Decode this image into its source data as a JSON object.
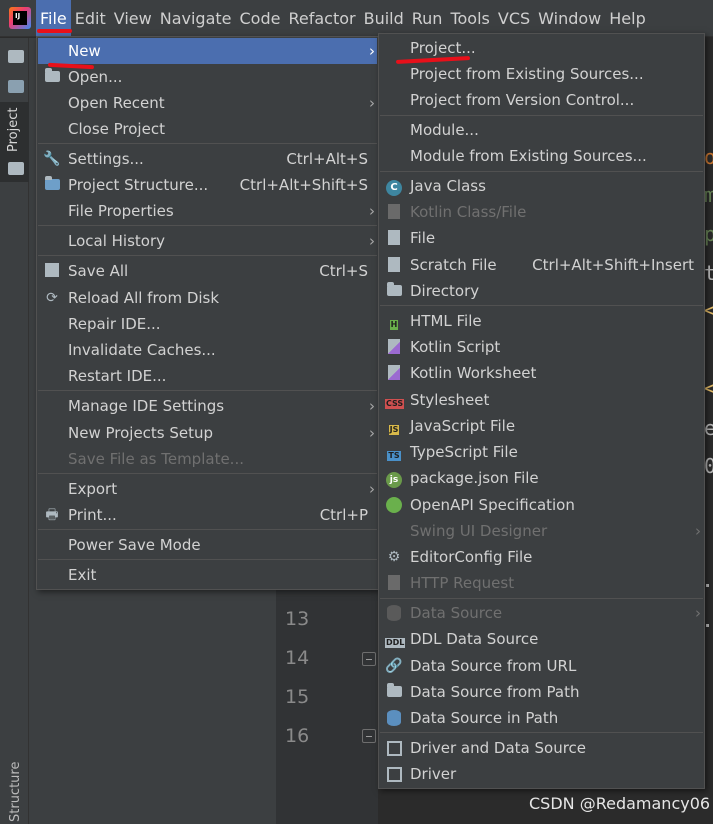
{
  "menubar": {
    "logo_text": "IJ",
    "items": [
      "File",
      "Edit",
      "View",
      "Navigate",
      "Code",
      "Refactor",
      "Build",
      "Run",
      "Tools",
      "VCS",
      "Window",
      "Help"
    ]
  },
  "sidebar": {
    "project_label": "Project",
    "structure_label": "Structure"
  },
  "gutter": {
    "line_numbers": [
      "13",
      "14",
      "15",
      "16"
    ]
  },
  "editor": {
    "code_chars": [
      "o",
      "m",
      "p",
      "t",
      "<",
      "<",
      "e",
      "0"
    ]
  },
  "watermark": "CSDN @Redamancy06",
  "file_menu": {
    "items": [
      {
        "label": "New",
        "shortcut": "",
        "arrow": "›"
      },
      {
        "label": "Open...",
        "shortcut": "",
        "arrow": ""
      },
      {
        "label": "Open Recent",
        "shortcut": "",
        "arrow": "›"
      },
      {
        "label": "Close Project",
        "shortcut": "",
        "arrow": ""
      },
      {
        "label": "Settings...",
        "shortcut": "Ctrl+Alt+S",
        "arrow": ""
      },
      {
        "label": "Project Structure...",
        "shortcut": "Ctrl+Alt+Shift+S",
        "arrow": ""
      },
      {
        "label": "File Properties",
        "shortcut": "",
        "arrow": "›"
      },
      {
        "label": "Local History",
        "shortcut": "",
        "arrow": "›"
      },
      {
        "label": "Save All",
        "shortcut": "Ctrl+S",
        "arrow": ""
      },
      {
        "label": "Reload All from Disk",
        "shortcut": "",
        "arrow": ""
      },
      {
        "label": "Repair IDE...",
        "shortcut": "",
        "arrow": ""
      },
      {
        "label": "Invalidate Caches...",
        "shortcut": "",
        "arrow": ""
      },
      {
        "label": "Restart IDE...",
        "shortcut": "",
        "arrow": ""
      },
      {
        "label": "Manage IDE Settings",
        "shortcut": "",
        "arrow": "›"
      },
      {
        "label": "New Projects Setup",
        "shortcut": "",
        "arrow": "›"
      },
      {
        "label": "Save File as Template...",
        "shortcut": "",
        "arrow": ""
      },
      {
        "label": "Export",
        "shortcut": "",
        "arrow": "›"
      },
      {
        "label": "Print...",
        "shortcut": "Ctrl+P",
        "arrow": ""
      },
      {
        "label": "Power Save Mode",
        "shortcut": "",
        "arrow": ""
      },
      {
        "label": "Exit",
        "shortcut": "",
        "arrow": ""
      }
    ]
  },
  "new_menu": {
    "items": [
      {
        "label": "Project...",
        "shortcut": "",
        "arrow": ""
      },
      {
        "label": "Project from Existing Sources...",
        "shortcut": "",
        "arrow": ""
      },
      {
        "label": "Project from Version Control...",
        "shortcut": "",
        "arrow": ""
      },
      {
        "label": "Module...",
        "shortcut": "",
        "arrow": ""
      },
      {
        "label": "Module from Existing Sources...",
        "shortcut": "",
        "arrow": ""
      },
      {
        "label": "Java Class",
        "shortcut": "",
        "arrow": ""
      },
      {
        "label": "Kotlin Class/File",
        "shortcut": "",
        "arrow": ""
      },
      {
        "label": "File",
        "shortcut": "",
        "arrow": ""
      },
      {
        "label": "Scratch File",
        "shortcut": "Ctrl+Alt+Shift+Insert",
        "arrow": ""
      },
      {
        "label": "Directory",
        "shortcut": "",
        "arrow": ""
      },
      {
        "label": "HTML File",
        "shortcut": "",
        "arrow": ""
      },
      {
        "label": "Kotlin Script",
        "shortcut": "",
        "arrow": ""
      },
      {
        "label": "Kotlin Worksheet",
        "shortcut": "",
        "arrow": ""
      },
      {
        "label": "Stylesheet",
        "shortcut": "",
        "arrow": ""
      },
      {
        "label": "JavaScript File",
        "shortcut": "",
        "arrow": ""
      },
      {
        "label": "TypeScript File",
        "shortcut": "",
        "arrow": ""
      },
      {
        "label": "package.json File",
        "shortcut": "",
        "arrow": ""
      },
      {
        "label": "OpenAPI Specification",
        "shortcut": "",
        "arrow": ""
      },
      {
        "label": "Swing UI Designer",
        "shortcut": "",
        "arrow": "›"
      },
      {
        "label": "EditorConfig File",
        "shortcut": "",
        "arrow": ""
      },
      {
        "label": "HTTP Request",
        "shortcut": "",
        "arrow": ""
      },
      {
        "label": "Data Source",
        "shortcut": "",
        "arrow": "›"
      },
      {
        "label": "DDL Data Source",
        "shortcut": "",
        "arrow": ""
      },
      {
        "label": "Data Source from URL",
        "shortcut": "",
        "arrow": ""
      },
      {
        "label": "Data Source from Path",
        "shortcut": "",
        "arrow": ""
      },
      {
        "label": "Data Source in Path",
        "shortcut": "",
        "arrow": ""
      },
      {
        "label": "Driver and Data Source",
        "shortcut": "",
        "arrow": ""
      },
      {
        "label": "Driver",
        "shortcut": "",
        "arrow": ""
      }
    ]
  },
  "icons": {
    "java_class": "C",
    "javascript": "JS",
    "typescript": "TS",
    "stylesheet": "CSS",
    "html": "H",
    "ddl": "DDL",
    "package_json": "js"
  },
  "colors": {
    "highlight": "#4b6eaf",
    "annotation_red": "#e8101a",
    "menu_bg": "#3c3f41",
    "editor_bg": "#2b2b2b"
  }
}
